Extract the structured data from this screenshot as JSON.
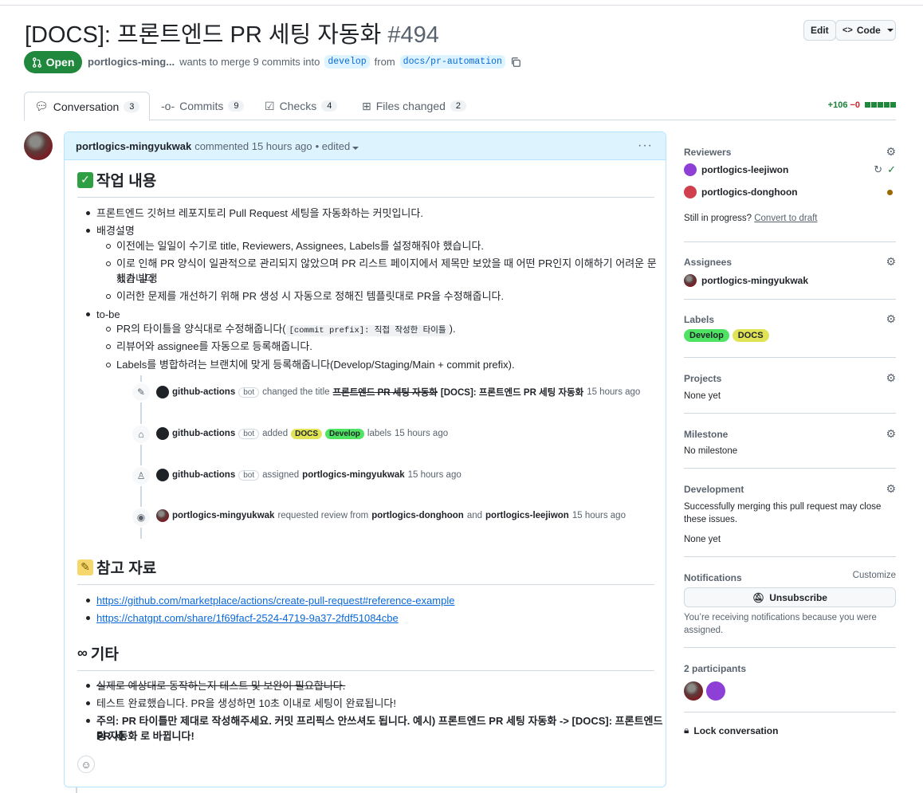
{
  "pr": {
    "title": "[DOCS]: 프론트엔드 PR 세팅 자동화",
    "number": "#494",
    "edit_label": "Edit",
    "code_label": "Code",
    "status": "Open",
    "author_short": "portlogics-ming...",
    "merge_text": "wants to merge 9 commits into",
    "base_branch": "develop",
    "from_text": "from",
    "head_branch": "docs/pr-automation"
  },
  "tabs": [
    {
      "label": "Conversation",
      "count": "3"
    },
    {
      "label": "Commits",
      "count": "9"
    },
    {
      "label": "Checks",
      "count": "4"
    },
    {
      "label": "Files changed",
      "count": "2"
    }
  ],
  "diffstat": {
    "additions": "+106",
    "deletions": "−0"
  },
  "comment": {
    "author": "portlogics-mingyukwak",
    "action": "commented 15 hours ago",
    "edited": "• edited",
    "section1_title": "작업 내용",
    "s1_items": [
      "프론트엔드 깃허브 레포지토리 Pull Request 세팅을 자동화하는 커밋입니다.",
      "배경설명",
      "이전에는 일일이 수기로 title, Reviewers, Assignees, Labels를 설정해줘야 했습니다.",
      "이로 인해 PR 양식이 일관적으로 관리되지 않았으며 PR 리스트 페이지에서 제목만 보았을 때 어떤 PR인지 이해하기 어려운 문제가 발생",
      "했습니다.",
      "이러한 문제를 개선하기 위해 PR 생성 시 자동으로 정해진 템플릿대로 PR을 수정해줍니다.",
      "to-be",
      "PR의 타이틀을 양식대로 수정해줍니다(",
      "[commit prefix]: 직접 작성한 타이틀",
      ").",
      "리뷰어와 assignee를 자동으로 등록해줍니다.",
      "Labels를 병합하려는 브랜치에 맞게 등록해줍니다(Develop/Staging/Main + commit prefix)."
    ],
    "section2_title": "참고 자료",
    "links": [
      "https://github.com/marketplace/actions/create-pull-request#reference-example",
      "https://chatgpt.com/share/1f69facf-2524-4719-9a37-2fdf51084cbe"
    ],
    "section3_title": "기타",
    "s3_items": [
      "실제로 예상대로 동작하는지 테스트 및 보완이 필요합니다.",
      "테스트 완료했습니다. PR을 생성하면 10초 이내로 세팅이 완료됩니다!",
      "주의: PR 타이틀만 제대로 작성해주세요. 커밋 프리픽스 안쓰셔도 됩니다. 예시) 프론트엔드 PR 세팅 자동화 -> [DOCS]: 프론트엔드 PR 세",
      "팅 자동화 로 바뀝니다!"
    ]
  },
  "timeline": [
    {
      "actor": "github-actions",
      "bot": "bot",
      "pre": "changed the title",
      "old_title": "프론트엔드 PR 세팅 자동화",
      "new_title": "[DOCS]: 프론트엔드 PR 세팅 자동화",
      "time": "15 hours ago"
    },
    {
      "actor": "github-actions",
      "bot": "bot",
      "pre": "added",
      "label1": "DOCS",
      "label2": "Develop",
      "post": "labels",
      "time": "15 hours ago"
    },
    {
      "actor": "github-actions",
      "bot": "bot",
      "pre": "assigned",
      "target": "portlogics-mingyukwak",
      "time": "15 hours ago"
    },
    {
      "actor": "portlogics-mingyukwak",
      "pre": "requested review from",
      "target1": "portlogics-donghoon",
      "and": "and",
      "target2": "portlogics-leejiwon",
      "time": "15 hours ago"
    }
  ],
  "sidebar": {
    "reviewers_title": "Reviewers",
    "reviewer1": "portlogics-leejiwon",
    "reviewer2": "portlogics-donghoon",
    "in_progress": "Still in progress?",
    "convert_draft": "Convert to draft",
    "assignees_title": "Assignees",
    "assignee": "portlogics-mingyukwak",
    "labels_title": "Labels",
    "label_develop": "Develop",
    "label_docs": "DOCS",
    "projects_title": "Projects",
    "projects_value": "None yet",
    "milestone_title": "Milestone",
    "milestone_value": "No milestone",
    "development_title": "Development",
    "development_text1": "Successfully merging this pull request may close",
    "development_text2": "these issues.",
    "development_value": "None yet",
    "notifications_title": "Notifications",
    "customize": "Customize",
    "unsubscribe": "Unsubscribe",
    "notif_text1": "You’re receiving notifications because you were",
    "notif_text2": "assigned.",
    "participants_title": "2 participants",
    "lock": "Lock conversation"
  },
  "colors": {
    "open": "#1f883d",
    "develop_label": "#4ee363",
    "docs_label": "#dfe355",
    "link": "#0969da"
  }
}
